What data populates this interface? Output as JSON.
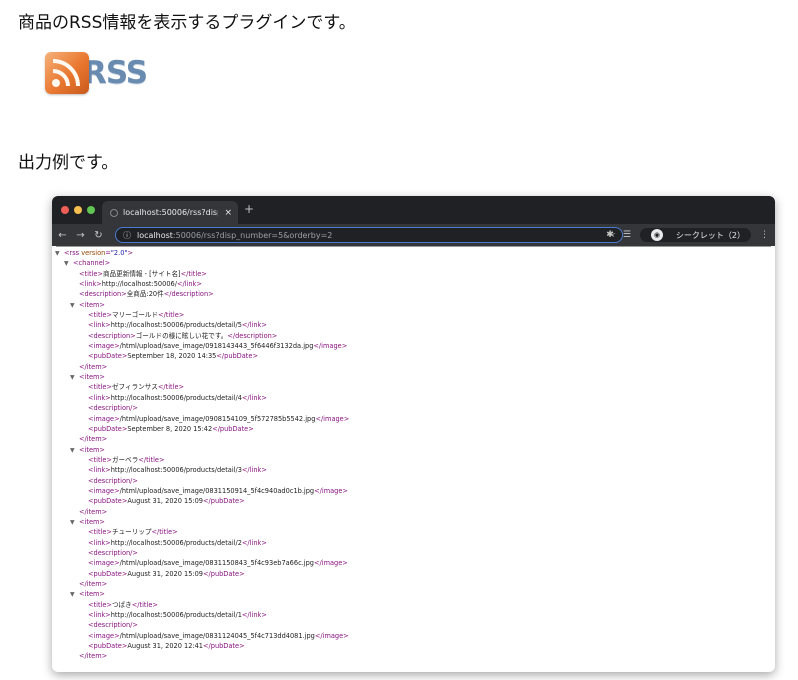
{
  "heading_plugin": "商品のRSS情報を表示するプラグインです。",
  "logo_text": "RSS",
  "heading_example": "出力例です。",
  "browser": {
    "tab_title": "localhost:50006/rss?disp_num",
    "tab_close": "×",
    "new_tab": "+",
    "url_host": "localhost",
    "url_path": ":50006/rss?disp_number=5&orderby=2",
    "profile_label": "シークレット（2）",
    "icons": [
      "back-arrow-icon",
      "forward-arrow-icon",
      "reload-icon",
      "info-icon",
      "star-icon",
      "extensions-icon",
      "reading-list-icon",
      "incognito-icon",
      "menu-icon"
    ]
  },
  "xml": {
    "rss_open": "<rss version=\"2.0\">",
    "channel_open": "<channel>",
    "channel_title": "商品更新情報 - [サイト名]",
    "channel_link": "http://localhost:50006/",
    "channel_description": "全商品:20件",
    "items": [
      {
        "title": "マリーゴールド",
        "link": "http://localhost:50006/products/detail/5",
        "description": "ゴールドの様に眩しい花です。",
        "image": "/html/upload/save_image/0918143443_5f6446f3132da.jpg",
        "pubDate": "September 18, 2020 14:35"
      },
      {
        "title": "ゼフィランサス",
        "link": "http://localhost:50006/products/detail/4",
        "description": "",
        "image": "/html/upload/save_image/0908154109_5f572785b5542.jpg",
        "pubDate": "September 8, 2020 15:42"
      },
      {
        "title": "ガーベラ",
        "link": "http://localhost:50006/products/detail/3",
        "description": "",
        "image": "/html/upload/save_image/0831150914_5f4c940ad0c1b.jpg",
        "pubDate": "August 31, 2020 15:09"
      },
      {
        "title": "チューリップ",
        "link": "http://localhost:50006/products/detail/2",
        "description": "",
        "image": "/html/upload/save_image/0831150843_5f4c93eb7a66c.jpg",
        "pubDate": "August 31, 2020 15:09"
      },
      {
        "title": "つばき",
        "link": "http://localhost:50006/products/detail/1",
        "description": "",
        "image": "/html/upload/save_image/0831124045_5f4c713dd4081.jpg",
        "pubDate": "August 31, 2020 12:41"
      }
    ]
  }
}
